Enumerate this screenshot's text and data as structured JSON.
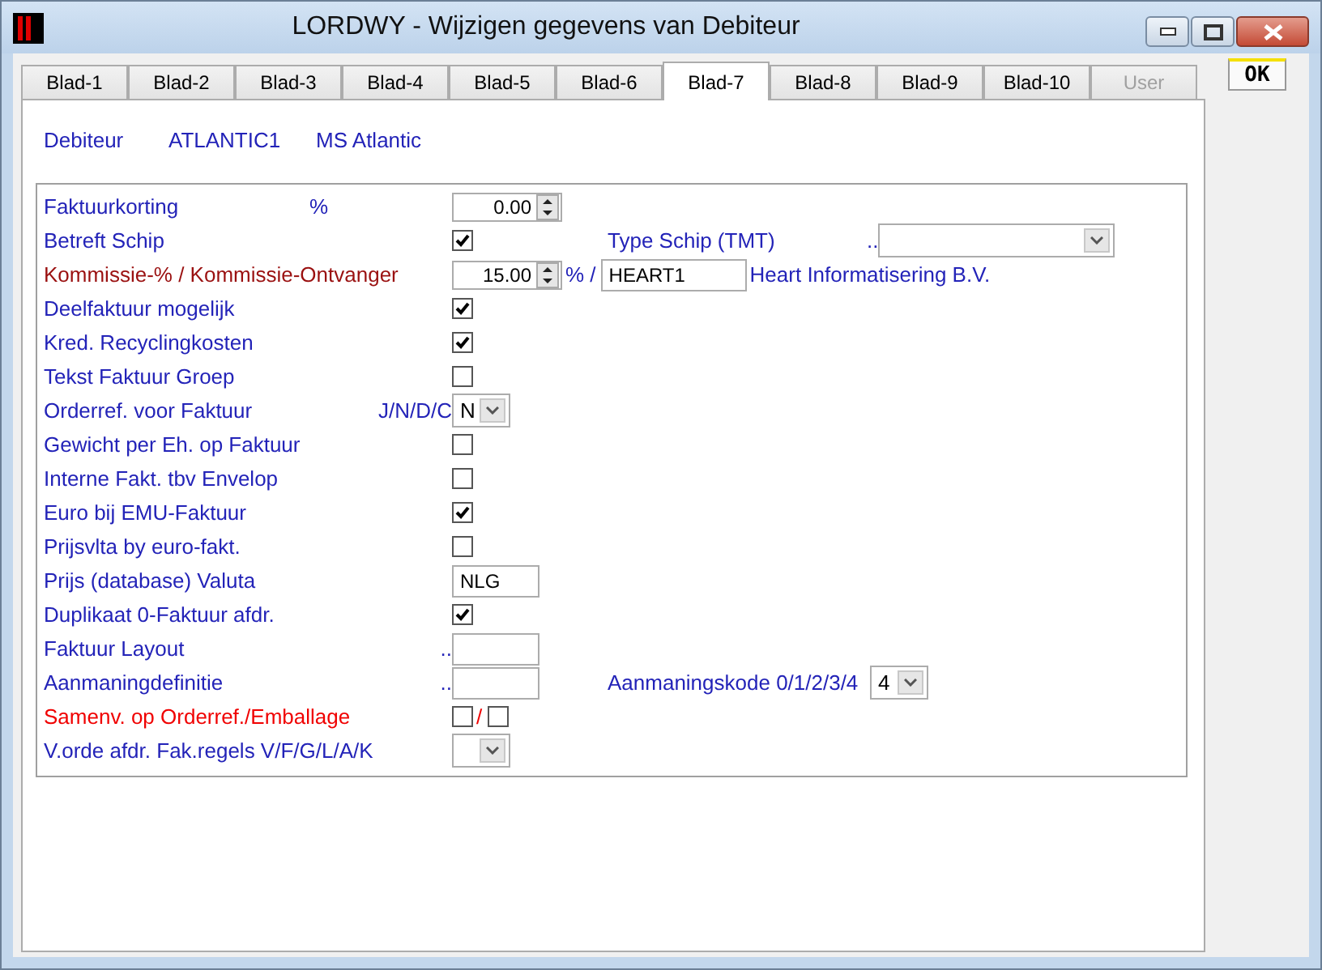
{
  "window": {
    "title": "LORDWY - Wijzigen gegevens van Debiteur"
  },
  "tabs": [
    {
      "label": "Blad-1",
      "selected": false,
      "disabled": false
    },
    {
      "label": "Blad-2",
      "selected": false,
      "disabled": false
    },
    {
      "label": "Blad-3",
      "selected": false,
      "disabled": false
    },
    {
      "label": "Blad-4",
      "selected": false,
      "disabled": false
    },
    {
      "label": "Blad-5",
      "selected": false,
      "disabled": false
    },
    {
      "label": "Blad-6",
      "selected": false,
      "disabled": false
    },
    {
      "label": "Blad-7",
      "selected": true,
      "disabled": false
    },
    {
      "label": "Blad-8",
      "selected": false,
      "disabled": false
    },
    {
      "label": "Blad-9",
      "selected": false,
      "disabled": false
    },
    {
      "label": "Blad-10",
      "selected": false,
      "disabled": false
    },
    {
      "label": "User",
      "selected": false,
      "disabled": true
    }
  ],
  "ok_button": "OK",
  "header": [
    "Debiteur",
    "ATLANTIC1",
    "MS Atlantic"
  ],
  "rows": [
    {
      "label": "Faktuurkorting",
      "color": "#2323b8",
      "unit": "%",
      "controls": [
        {
          "kind": "spin",
          "value": "0.00"
        }
      ]
    },
    {
      "label": "Betreft Schip",
      "color": "#2323b8",
      "controls": [
        {
          "kind": "checkbox",
          "checked": true
        }
      ],
      "right": {
        "label": "Type Schip (TMT)",
        "hint": "..",
        "control": {
          "kind": "combobox"
        }
      }
    },
    {
      "label": "Kommissie-% / Kommissie-Ontvanger",
      "color": "#9a1010",
      "controls": [
        {
          "kind": "spin",
          "value": "15.00"
        },
        {
          "kind": "text",
          "text": "% /"
        },
        {
          "kind": "input",
          "value": "HEART1"
        },
        {
          "kind": "text",
          "text": "Heart Informatisering B.V."
        }
      ]
    },
    {
      "label": "Deelfaktuur mogelijk",
      "color": "#2323b8",
      "controls": [
        {
          "kind": "checkbox",
          "checked": true
        }
      ]
    },
    {
      "label": "Kred. Recyclingkosten",
      "color": "#2323b8",
      "controls": [
        {
          "kind": "checkbox",
          "checked": true
        }
      ]
    },
    {
      "label": "Tekst Faktuur Groep",
      "color": "#2323b8",
      "controls": [
        {
          "kind": "checkbox",
          "checked": false
        }
      ]
    },
    {
      "label": "Orderref. voor Faktuur",
      "color": "#2323b8",
      "hint": "J/N/D/C",
      "controls": [
        {
          "kind": "select",
          "value": "N"
        }
      ]
    },
    {
      "label": "Gewicht per Eh. op Faktuur",
      "color": "#2323b8",
      "controls": [
        {
          "kind": "checkbox",
          "checked": false
        }
      ]
    },
    {
      "label": "Interne Fakt. tbv Envelop",
      "color": "#2323b8",
      "controls": [
        {
          "kind": "checkbox",
          "checked": false
        }
      ]
    },
    {
      "label": "Euro bij EMU-Faktuur",
      "color": "#2323b8",
      "controls": [
        {
          "kind": "checkbox",
          "checked": true
        }
      ]
    },
    {
      "label": "Prijsvlta by euro-fakt.",
      "color": "#2323b8",
      "controls": [
        {
          "kind": "checkbox",
          "checked": false
        }
      ]
    },
    {
      "label": "Prijs (database) Valuta",
      "color": "#2323b8",
      "controls": [
        {
          "kind": "input",
          "value": "NLG"
        }
      ]
    },
    {
      "label": "Duplikaat 0-Faktuur afdr.",
      "color": "#2323b8",
      "controls": [
        {
          "kind": "checkbox",
          "checked": true
        }
      ]
    },
    {
      "label": "Faktuur Layout",
      "color": "#2323b8",
      "hint": "..",
      "controls": [
        {
          "kind": "input"
        }
      ]
    },
    {
      "label": "Aanmaningdefinitie",
      "color": "#2323b8",
      "hint": "..",
      "controls": [
        {
          "kind": "input"
        }
      ],
      "right": {
        "label": "Aanmaningskode 0/1/2/3/4",
        "control": {
          "kind": "select",
          "value": "4"
        }
      }
    },
    {
      "label": "Samenv. op Orderref./Emballage",
      "color": "#f00000",
      "controls": [
        {
          "kind": "checkbox",
          "checked": false
        },
        {
          "kind": "text",
          "text": "/",
          "color": "#f00000"
        },
        {
          "kind": "checkbox",
          "checked": false
        }
      ]
    },
    {
      "label": "V.orde afdr. Fak.regels V/F/G/L/A/K",
      "color": "#2323b8",
      "controls": [
        {
          "kind": "select"
        }
      ]
    }
  ]
}
